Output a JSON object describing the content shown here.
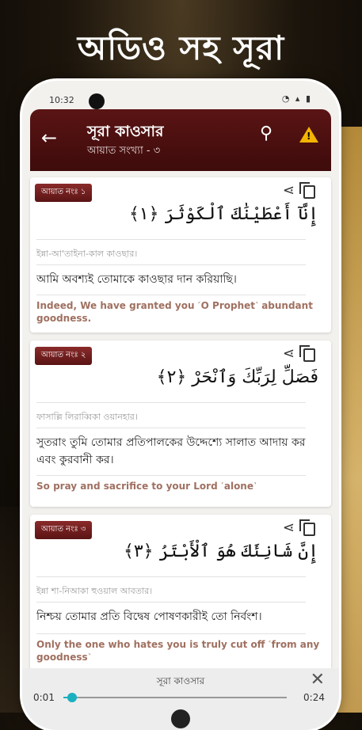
{
  "promo": {
    "title": "অডিও সহ সূরা"
  },
  "status": {
    "time": "10:32",
    "icons": "◔ ▴ ▮"
  },
  "appbar": {
    "title": "সূরা কাওসার",
    "subtitle": "আয়াত সংখ্যা - ৩",
    "back_icon": "←",
    "search_icon": "⚲",
    "warn_icon": "!"
  },
  "verses": [
    {
      "badge": "আয়াত নংঃ ১",
      "arabic": "إِنَّآ أَعْطَيْنَٰكَ ٱلْكَوْثَرَ ﴿١﴾",
      "translit": "ইন্না-আ'তাইনা-কাল কাওছার।",
      "bangla": "আমি অবশ্যই তোমাকে কাওছার দান করিয়াছি।",
      "english": "Indeed, We have granted you ˹O Prophet˺ abundant goodness."
    },
    {
      "badge": "আয়াত নংঃ ২",
      "arabic": "فَصَلِّ لِرَبِّكَ وَٱنْحَرْ ﴿٢﴾",
      "translit": "ফাসাল্লি লিরাব্বিকা ওয়ানহার।",
      "bangla": "সুতরাং তুমি তোমার প্রতিপালকের উদ্দেশ্যে সালাত আদায় কর এবং কুরবানী কর।",
      "english": "So pray and sacrifice to your Lord ˹alone˺"
    },
    {
      "badge": "আয়াত নংঃ ৩",
      "arabic": "إِنَّ شَانِئَكَ هُوَ ٱلْأَبْتَرُ ﴿٣﴾",
      "translit": "ইন্না শা-নিআকা হুওয়াল আবতার।",
      "bangla": "নিশ্চয় তোমার প্রতি বিদ্বেষ পোষণকারীই তো নির্বংশ।",
      "english": "Only the one who hates you is truly cut off ˹from any goodness˺"
    }
  ],
  "player": {
    "title": "সূরা কাওসার",
    "current": "0:01",
    "total": "0:24",
    "progress": 0.04,
    "close_icon": "✕"
  },
  "colors": {
    "appbar": "#5a1414",
    "accent": "#1ab0c0",
    "warn": "#f3b400"
  }
}
